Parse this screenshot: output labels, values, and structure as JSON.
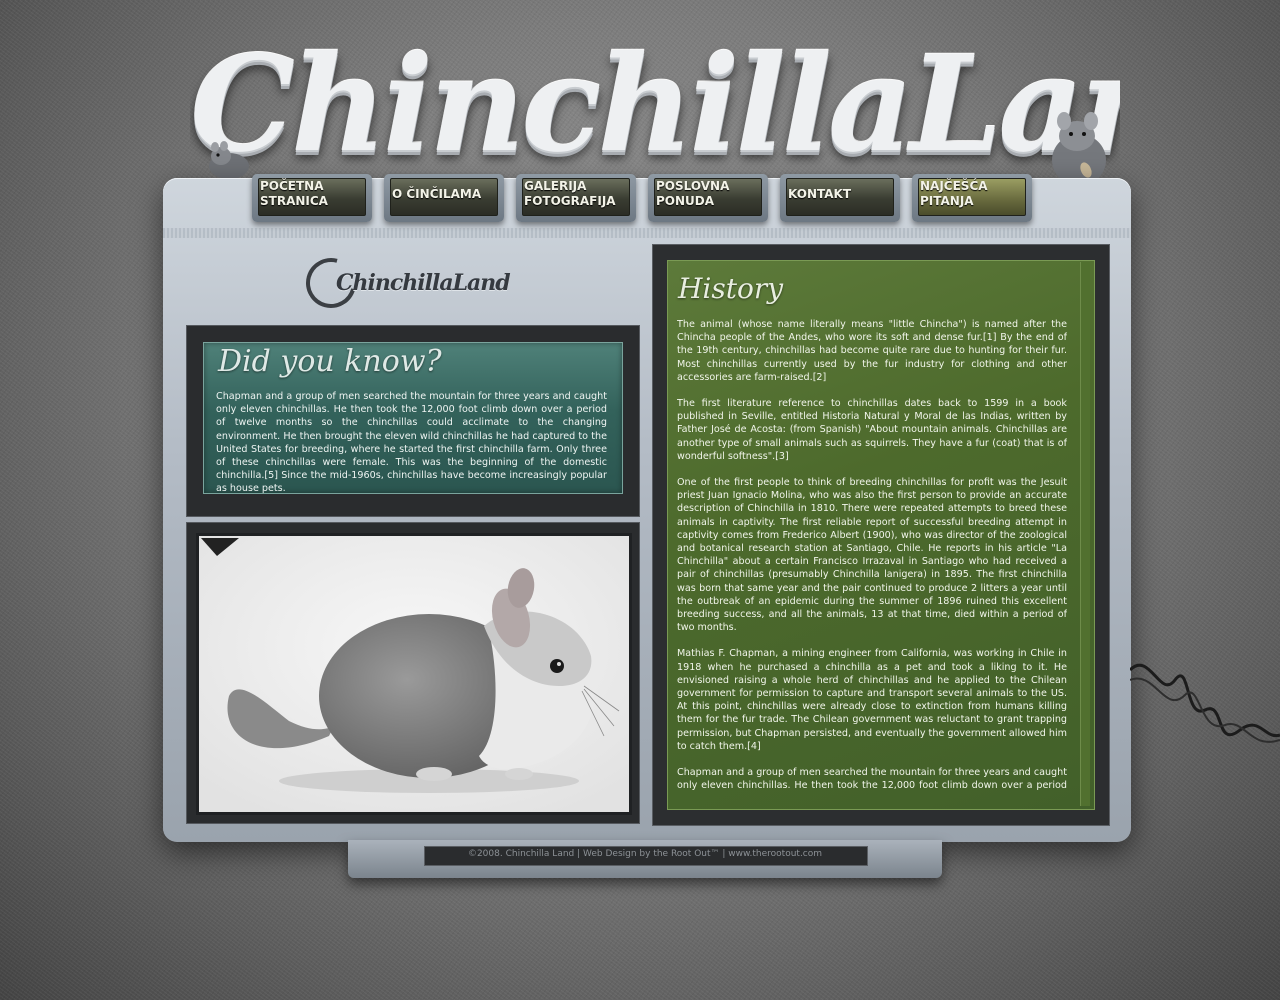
{
  "site": {
    "logo_text": "ChinchillaLand",
    "small_logo_text": "ChinchillaLand"
  },
  "nav": {
    "items": [
      {
        "label": "POČETNA\nSTRANICA"
      },
      {
        "label": "O ČINČILAMA"
      },
      {
        "label": "GALERIJA\nFOTOGRAFIJA"
      },
      {
        "label": "POSLOVNA\nPONUDA"
      },
      {
        "label": "KONTAKT"
      },
      {
        "label": "NAJČEŠĆA\nPITANJA"
      }
    ]
  },
  "did_you_know": {
    "title": "Did you know?",
    "text": "Chapman and a group of men searched the mountain for three years and caught only eleven chinchillas. He then took the 12,000 foot climb down over a period of twelve months so the chinchillas could acclimate to the changing environment. He then brought the eleven wild chinchillas he had captured to the United States for breeding, where he started the first chinchilla farm. Only three of these chinchillas were female. This was the beginning of the domestic chinchilla.[5] Since the mid-1960s, chinchillas have become increasingly popular as house pets."
  },
  "history": {
    "title": "History",
    "paragraphs": [
      "The animal (whose name literally means \"little Chincha\") is named after the Chincha people of the Andes, who wore its soft and dense fur.[1] By the end of the 19th century, chinchillas had become quite rare due to hunting for their fur. Most chinchillas currently used by the fur industry for clothing and other accessories are farm-raised.[2]",
      "The first literature reference to chinchillas dates back to 1599 in a book published in Seville, entitled Historia Natural y Moral de las Indias, written by Father José de Acosta: (from Spanish) \"About mountain animals. Chinchillas are another type of small animals such as squirrels. They have a fur (coat) that is of wonderful softness\".[3]",
      "One of the first people to think of breeding chinchillas for profit was the Jesuit priest Juan Ignacio Molina, who was also the first person to provide an accurate description of Chinchilla in 1810. There were repeated attempts to breed these animals in captivity. The first reliable report of successful breeding attempt in captivity comes from Frederico Albert (1900), who was director of the zoological and botanical research station at Santiago, Chile. He reports in his article \"La Chinchilla\" about a certain Francisco Irrazaval in Santiago who had received a pair of chinchillas (presumably Chinchilla lanigera) in 1895. The first chinchilla was born that same year and the pair continued to produce 2 litters a year until the outbreak of an epidemic during the summer of 1896 ruined this excellent breeding success, and all the animals, 13 at that time, died within a period of two months.",
      "Mathias F. Chapman, a mining engineer from California, was working in Chile in 1918 when he purchased a chinchilla as a pet and took a liking to it. He envisioned raising a whole herd of chinchillas and he applied to the Chilean government for permission to capture and transport several animals to the US. At this point, chinchillas were already close to extinction from humans killing them for the fur trade. The Chilean government was reluctant to grant trapping permission, but Chapman persisted, and eventually the government allowed him to catch them.[4]",
      "Chapman and a group of men searched the mountain for three years and caught only eleven chinchillas. He then took the 12,000 foot climb down over a period of twelve months so the chinchillas could acclimate to the changing environment. He then brought the eleven wild chinchillas he had captured to the United States for"
    ]
  },
  "footer": {
    "text": "©2008. Chinchilla Land | Web Design by the Root Out™ | www.therootout.com"
  },
  "colors": {
    "nav_active": "#9a9d62",
    "did_you_know_bg": "#33625b",
    "history_bg": "#4d6a2c"
  }
}
